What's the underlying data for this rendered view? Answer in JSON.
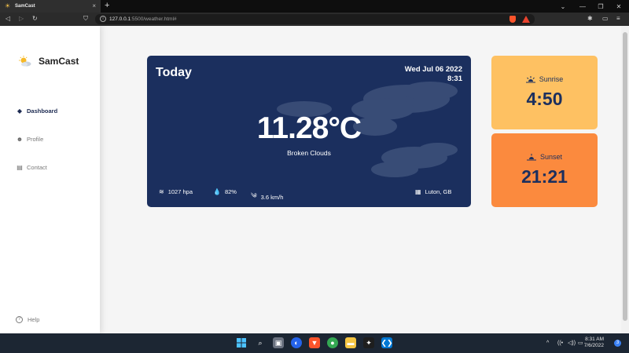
{
  "browser": {
    "tab_title": "SamCast",
    "tab_close": "×",
    "new_tab": "+",
    "url_host": "127.0.0.1",
    "url_rest": ":5500/weather.html#",
    "brave_badge": "2",
    "controls": {
      "dropdown": "⌄",
      "minimize": "—",
      "restore": "❐",
      "close": "✕"
    }
  },
  "app": {
    "brand": "SamCast"
  },
  "sidebar": {
    "items": [
      {
        "label": "Dashboard",
        "icon": "layers-icon",
        "active": true
      },
      {
        "label": "Profile",
        "icon": "user-edit-icon",
        "active": false
      },
      {
        "label": "Contact",
        "icon": "id-card-icon",
        "active": false
      }
    ],
    "help": {
      "label": "Help",
      "icon": "question-circle-icon"
    }
  },
  "weather": {
    "title": "Today",
    "date": "Wed Jul 06 2022",
    "time": "8:31",
    "temperature": "11.28°C",
    "description": "Broken Clouds",
    "pressure": "1027 hpa",
    "humidity": "82%",
    "wind": "3.6 km/h",
    "location": "Luton,  GB"
  },
  "sun": {
    "sunrise_label": "Sunrise",
    "sunrise_time": "4:50",
    "sunset_label": "Sunset",
    "sunset_time": "21:21"
  },
  "taskbar": {
    "time": "8:31 AM",
    "date": "7/6/2022",
    "notifications": "3",
    "tray_chevron": "^"
  },
  "colors": {
    "card_bg": "#1b2f5e",
    "sunrise_bg": "#fec162",
    "sunset_bg": "#fb8a3e",
    "accent_text": "#1b2f5e"
  }
}
